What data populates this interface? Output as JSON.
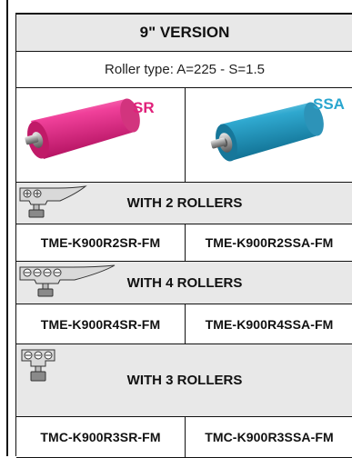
{
  "header": {
    "title": "9\" VERSION",
    "roller_type": "Roller type: A=225 - S=1.5"
  },
  "rollers": [
    {
      "label": "SR",
      "color": "#e0207a"
    },
    {
      "label": "SSA",
      "color": "#2aa6cf"
    }
  ],
  "sections": [
    {
      "label": "WITH 2 ROLLERS",
      "codes": [
        "TME-K900R2SR-FM",
        "TME-K900R2SSA-FM"
      ]
    },
    {
      "label": "WITH 4 ROLLERS",
      "codes": [
        "TME-K900R4SR-FM",
        "TME-K900R4SSA-FM"
      ]
    },
    {
      "label": "WITH 3 ROLLERS",
      "codes": [
        "TMC-K900R3SR-FM",
        "TMC-K900R3SSA-FM"
      ]
    }
  ]
}
